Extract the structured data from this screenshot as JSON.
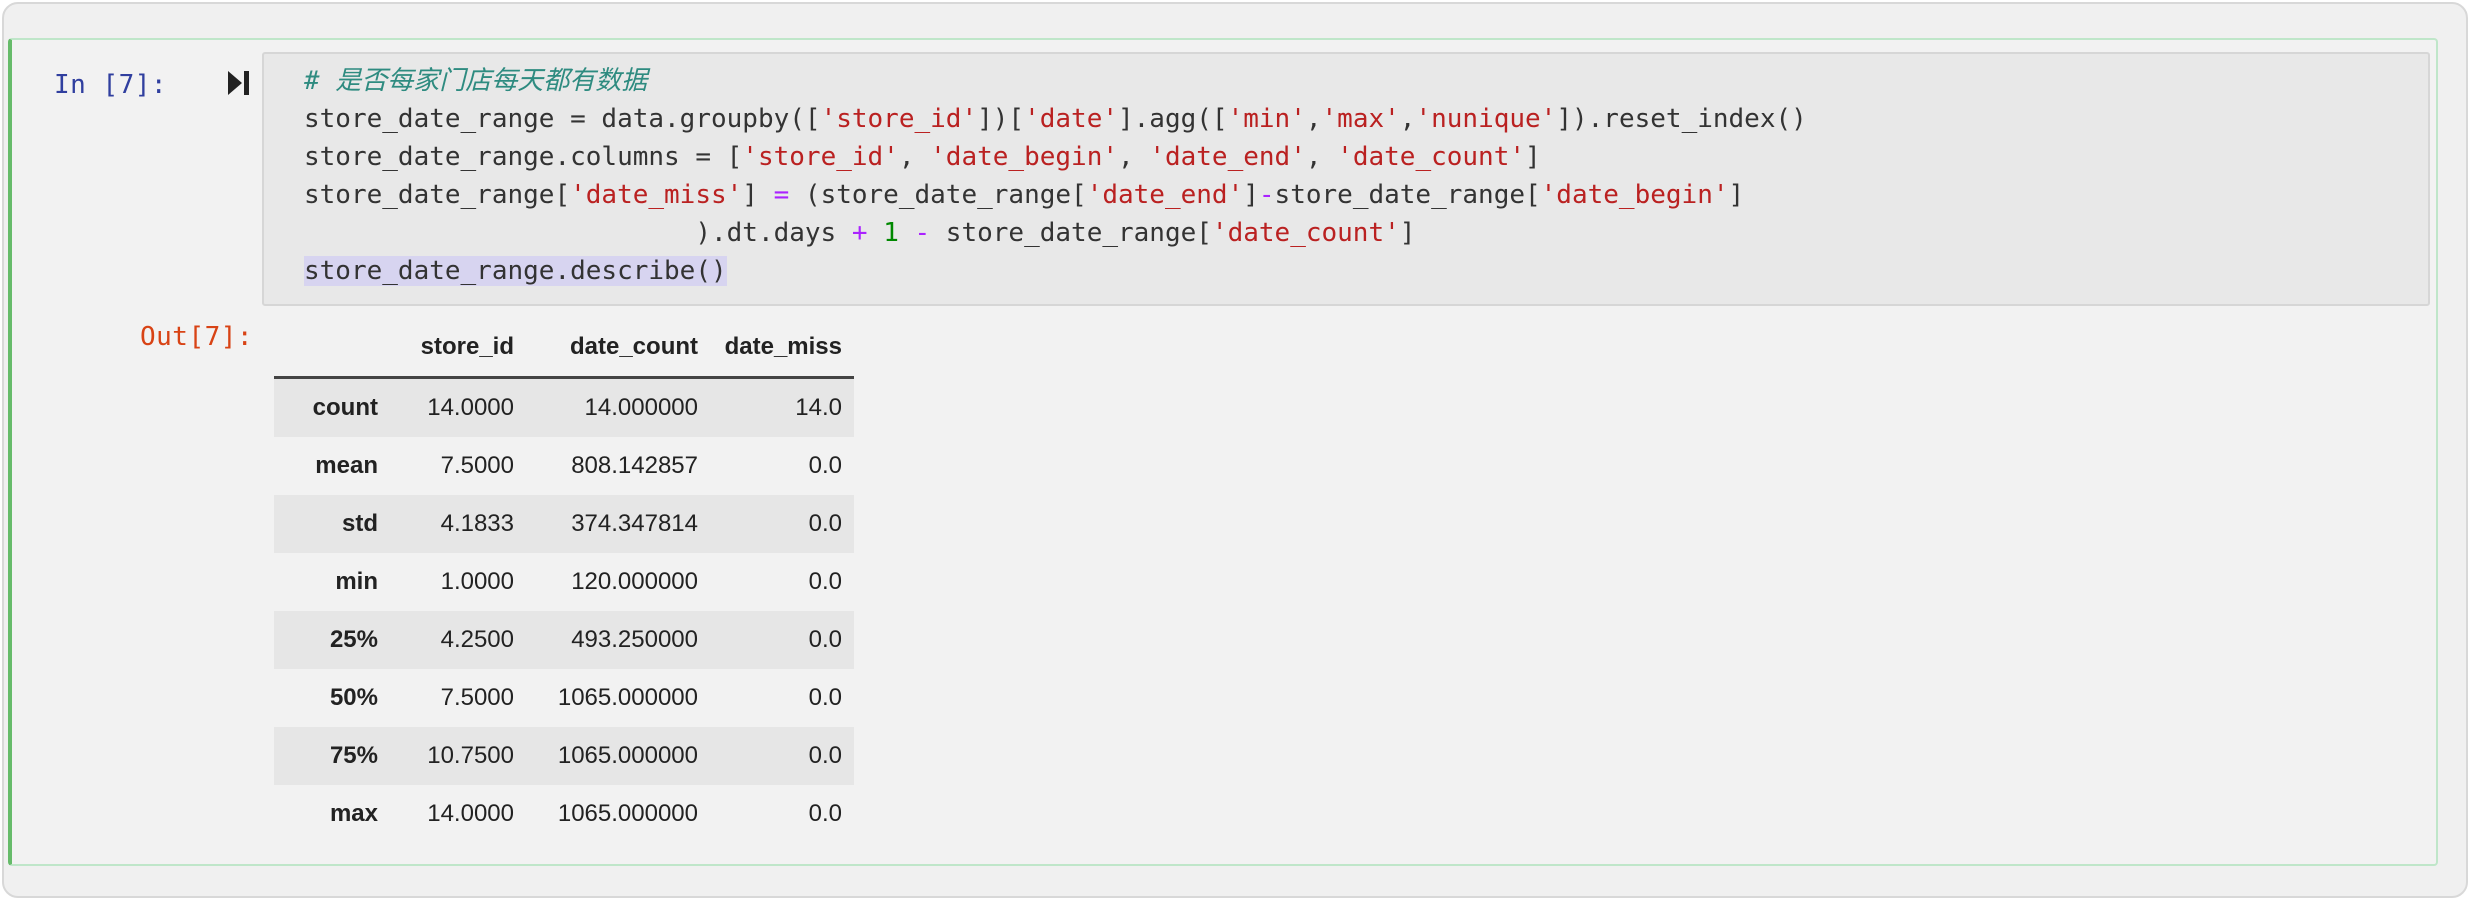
{
  "input_prompt": "In  [7]:",
  "output_prompt": "Out[7]:",
  "run_icon": "run-cell-icon",
  "code": {
    "comment": "# 是否每家门店每天都有数据",
    "line1": [
      "store_date_range = data.groupby([",
      "'store_id'",
      "])[",
      "'date'",
      "].agg([",
      "'min'",
      ",",
      "'max'",
      ",",
      "'nunique'",
      "]).reset_index()"
    ],
    "line2": [
      "store_date_range.columns = [",
      "'store_id'",
      ", ",
      "'date_begin'",
      ", ",
      "'date_end'",
      ", ",
      "'date_count'",
      "]"
    ],
    "line3": [
      "store_date_range[",
      "'date_miss'",
      "] ",
      "=",
      " (store_date_range[",
      "'date_end'",
      "]",
      "-",
      "store_date_range[",
      "'date_begin'",
      "]"
    ],
    "line4": [
      "                         ).dt.days ",
      "+",
      " ",
      "1",
      " ",
      "-",
      " store_date_range[",
      "'date_count'",
      "]"
    ],
    "line5": "store_date_range.describe()"
  },
  "table": {
    "columns": [
      "",
      "store_id",
      "date_count",
      "date_miss"
    ],
    "rows": [
      {
        "index": "count",
        "store_id": "14.0000",
        "date_count": "14.000000",
        "date_miss": "14.0"
      },
      {
        "index": "mean",
        "store_id": "7.5000",
        "date_count": "808.142857",
        "date_miss": "0.0"
      },
      {
        "index": "std",
        "store_id": "4.1833",
        "date_count": "374.347814",
        "date_miss": "0.0"
      },
      {
        "index": "min",
        "store_id": "1.0000",
        "date_count": "120.000000",
        "date_miss": "0.0"
      },
      {
        "index": "25%",
        "store_id": "4.2500",
        "date_count": "493.250000",
        "date_miss": "0.0"
      },
      {
        "index": "50%",
        "store_id": "7.5000",
        "date_count": "1065.000000",
        "date_miss": "0.0"
      },
      {
        "index": "75%",
        "store_id": "10.7500",
        "date_count": "1065.000000",
        "date_miss": "0.0"
      },
      {
        "index": "max",
        "store_id": "14.0000",
        "date_count": "1065.000000",
        "date_miss": "0.0"
      }
    ]
  },
  "colors": {
    "input_prompt": "#303f9f",
    "output_prompt": "#d84315",
    "cell_border": "#66bb6a",
    "string": "#ba2121",
    "comment": "#2e8b80",
    "operator": "#aa22ff",
    "number": "#008800"
  }
}
